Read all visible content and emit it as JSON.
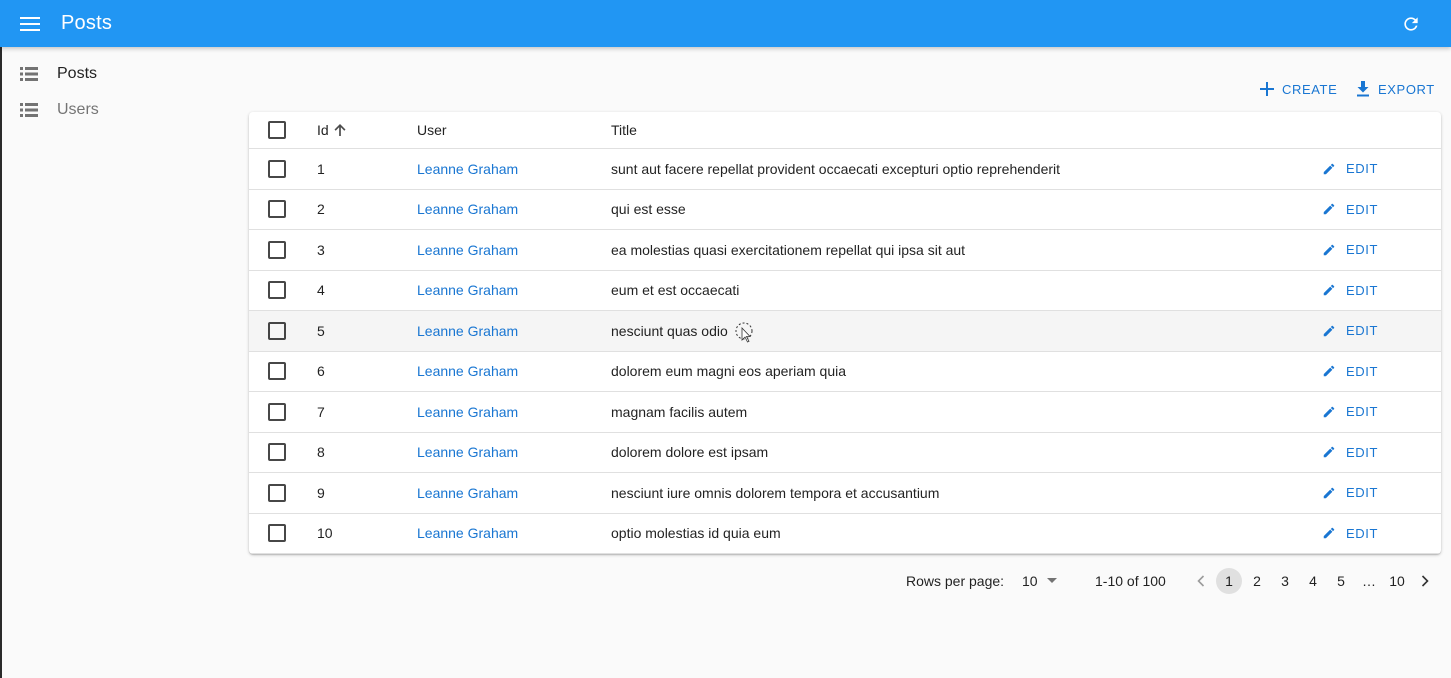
{
  "appbar": {
    "title": "Posts",
    "bg_color": "#2196f3",
    "menu_icon": "menu-icon",
    "refresh_icon": "refresh-icon"
  },
  "sidebar": {
    "items": [
      {
        "label": "Posts",
        "icon": "list-icon",
        "active": true
      },
      {
        "label": "Users",
        "icon": "list-icon",
        "active": false
      }
    ]
  },
  "toolbar": {
    "create_label": "CREATE",
    "export_label": "EXPORT",
    "accent_color": "#1976d2"
  },
  "table": {
    "columns": [
      "Id",
      "User",
      "Title"
    ],
    "sort_column": "Id",
    "sort_direction": "asc",
    "edit_label": "EDIT",
    "rows": [
      {
        "id": "1",
        "user": "Leanne Graham",
        "title": "sunt aut facere repellat provident occaecati excepturi optio reprehenderit"
      },
      {
        "id": "2",
        "user": "Leanne Graham",
        "title": "qui est esse"
      },
      {
        "id": "3",
        "user": "Leanne Graham",
        "title": "ea molestias quasi exercitationem repellat qui ipsa sit aut"
      },
      {
        "id": "4",
        "user": "Leanne Graham",
        "title": "eum et est occaecati"
      },
      {
        "id": "5",
        "user": "Leanne Graham",
        "title": "nesciunt quas odio"
      },
      {
        "id": "6",
        "user": "Leanne Graham",
        "title": "dolorem eum magni eos aperiam quia"
      },
      {
        "id": "7",
        "user": "Leanne Graham",
        "title": "magnam facilis autem"
      },
      {
        "id": "8",
        "user": "Leanne Graham",
        "title": "dolorem dolore est ipsam"
      },
      {
        "id": "9",
        "user": "Leanne Graham",
        "title": "nesciunt iure omnis dolorem tempora et accusantium"
      },
      {
        "id": "10",
        "user": "Leanne Graham",
        "title": "optio molestias id quia eum"
      }
    ]
  },
  "pagination": {
    "rows_per_page_label": "Rows per page:",
    "rows_per_page_value": "10",
    "range_label": "1-10 of 100",
    "pages": [
      "1",
      "2",
      "3",
      "4",
      "5",
      "…",
      "10"
    ],
    "current_page": "1"
  }
}
